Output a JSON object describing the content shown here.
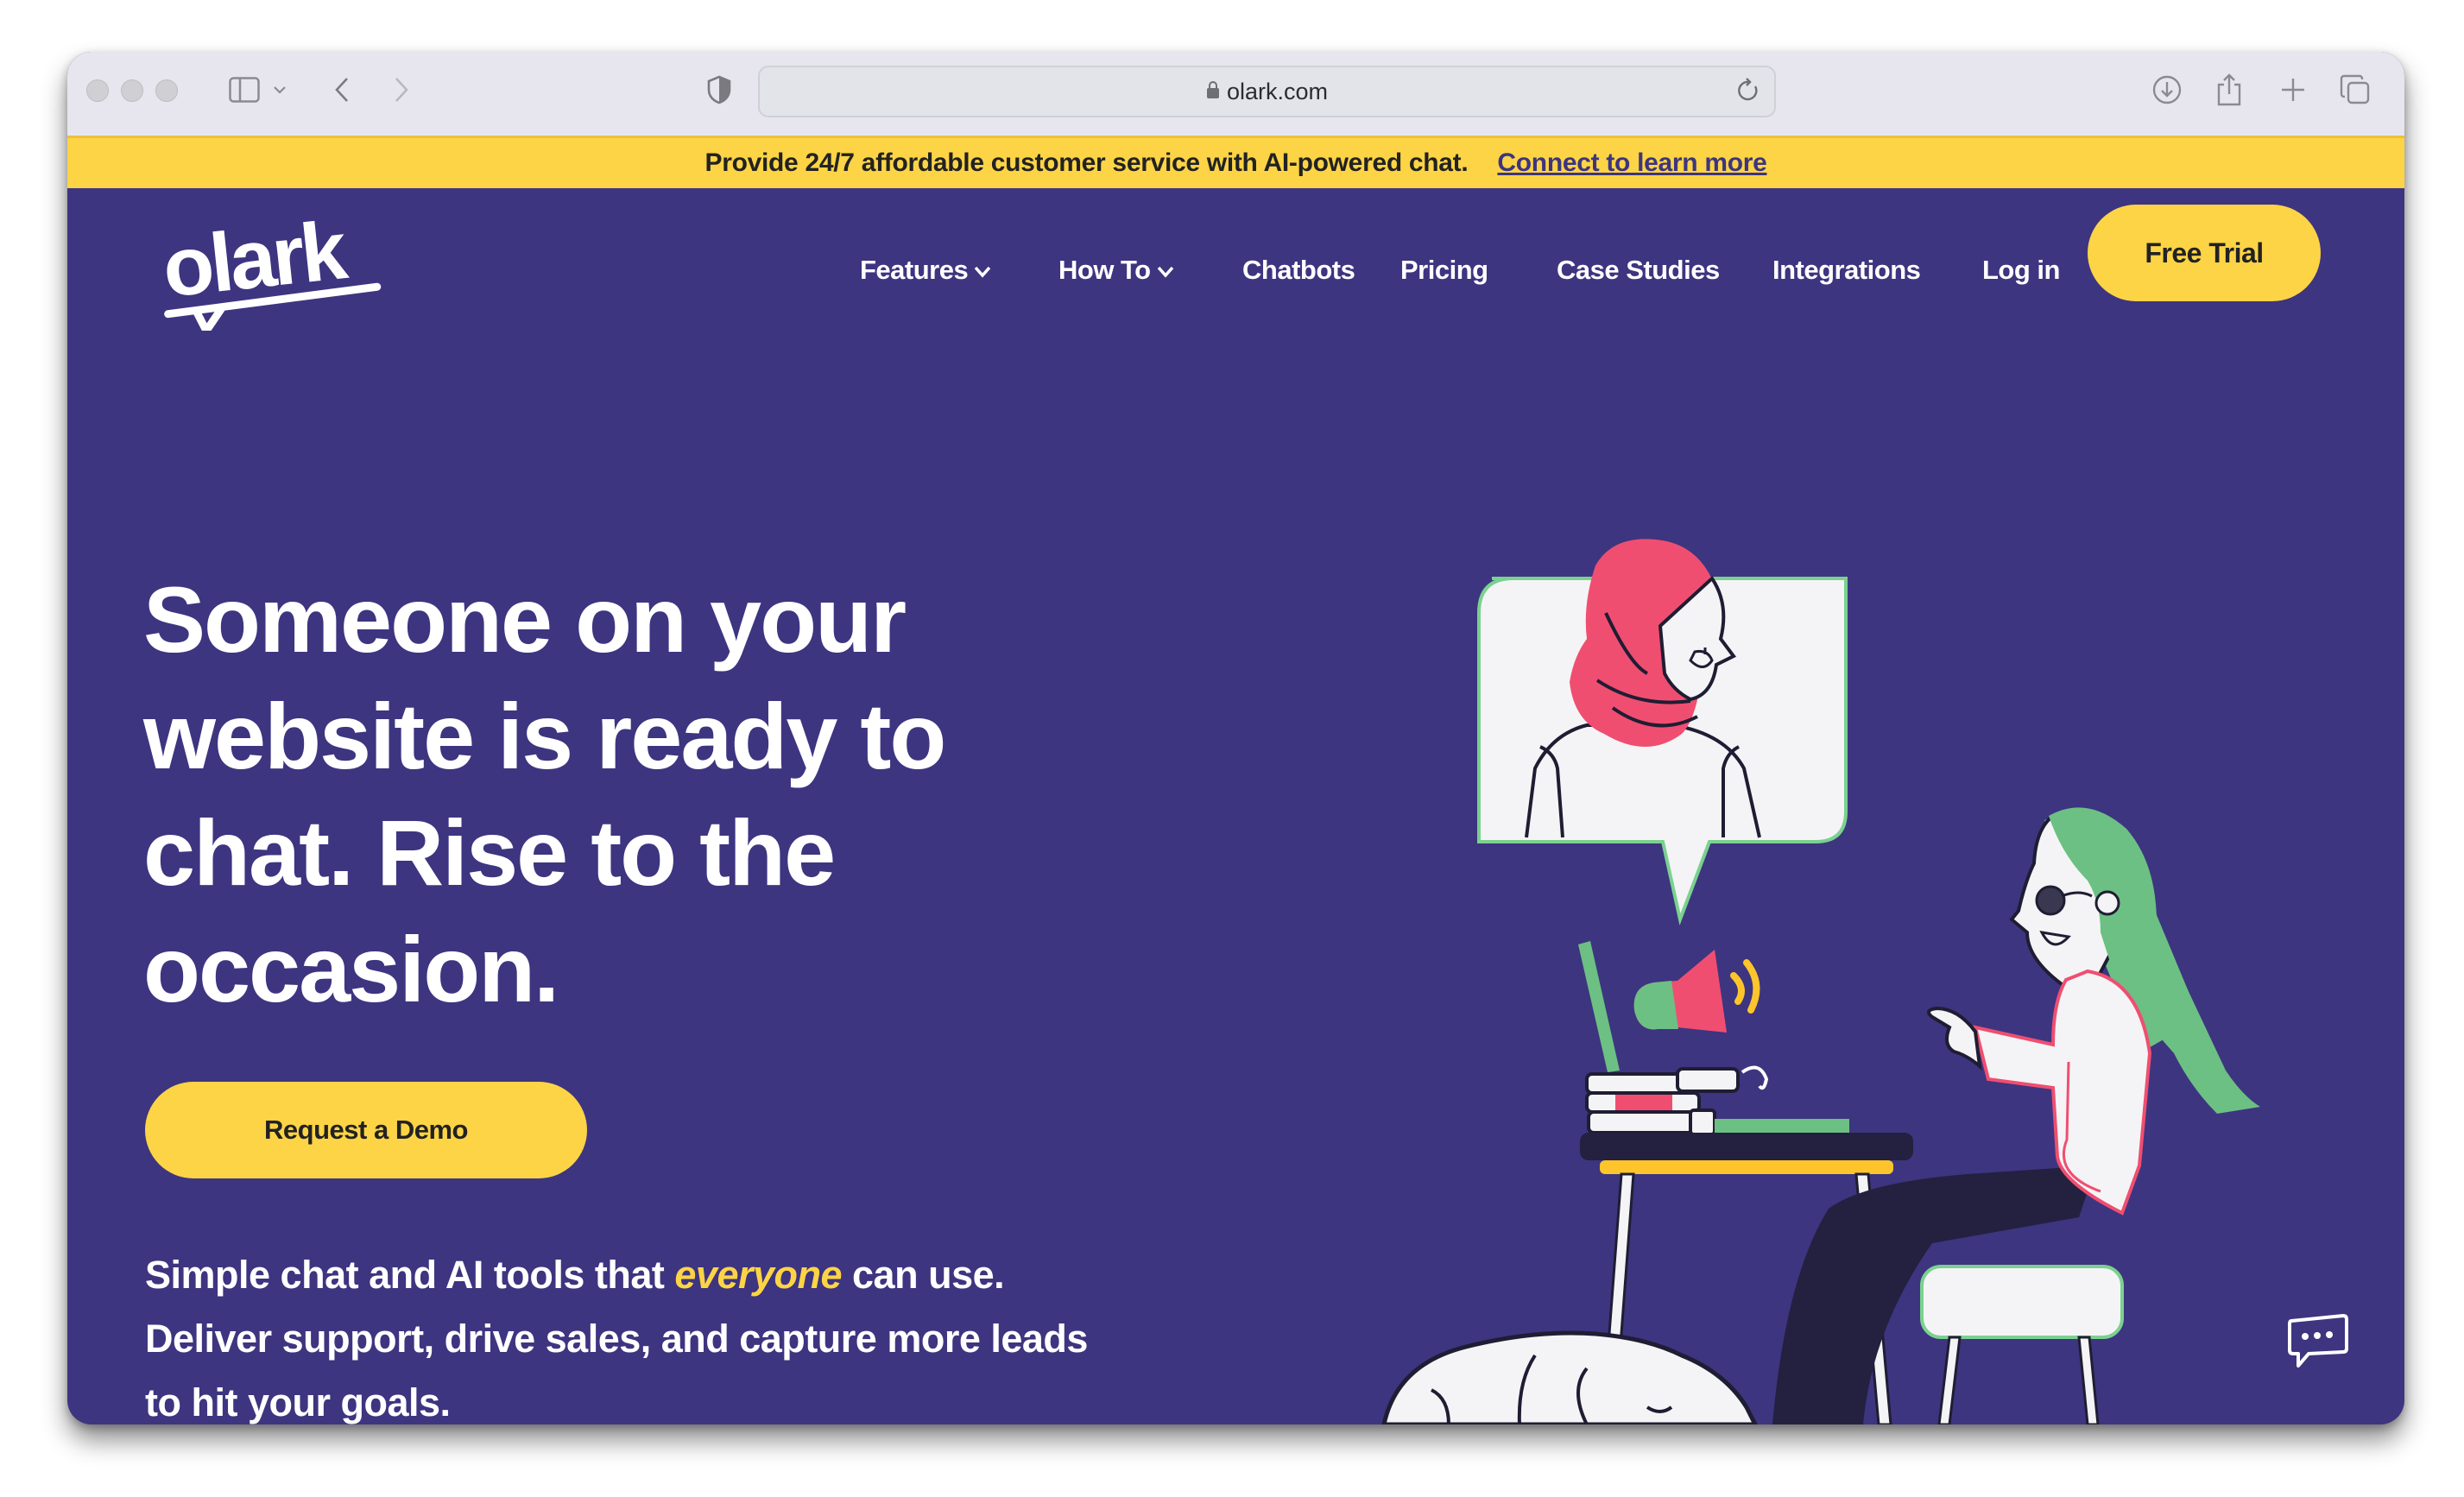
{
  "browser": {
    "url": "olark.com",
    "icons": [
      "sidebar-icon",
      "chevron-down-icon",
      "back-icon",
      "forward-icon",
      "shield-icon",
      "lock-icon",
      "reload-icon",
      "download-icon",
      "share-icon",
      "new-tab-icon",
      "tabs-icon"
    ]
  },
  "banner": {
    "text": "Provide 24/7 affordable customer service with AI-powered chat.",
    "link": "Connect to learn more"
  },
  "nav": {
    "logo": "olark",
    "items": [
      {
        "label": "Features",
        "dropdown": true
      },
      {
        "label": "How To",
        "dropdown": true
      },
      {
        "label": "Chatbots"
      },
      {
        "label": "Pricing"
      },
      {
        "label": "Case Studies"
      },
      {
        "label": "Integrations"
      },
      {
        "label": "Log in"
      }
    ],
    "cta": "Free Trial"
  },
  "hero": {
    "headline_lines": [
      "Someone on your",
      "website is ready to",
      "chat. Rise to the",
      "occasion."
    ],
    "demo_button": "Request a Demo",
    "sub_before": "Simple chat and AI tools that ",
    "sub_em": "everyone",
    "sub_after": " can use. Deliver support, drive sales, and capture more leads to hit your goals."
  },
  "colors": {
    "brand_purple": "#3d3580",
    "accent_yellow": "#fdd445",
    "pink": "#f04e70",
    "green": "#6cc083",
    "dark": "#23213f"
  },
  "chat_widget": {
    "icon": "chat-bubble-icon"
  }
}
